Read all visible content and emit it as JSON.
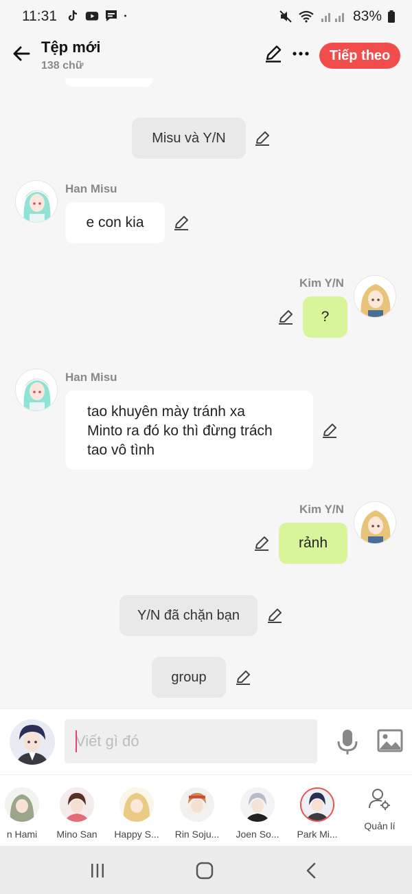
{
  "status_bar": {
    "time": "11:31",
    "battery": "83%",
    "left_icons": [
      "tiktok-icon",
      "youtube-icon",
      "message-icon",
      "dot-icon"
    ],
    "right_icons": [
      "mute-icon",
      "wifi-icon",
      "signal-icon",
      "battery-icon"
    ]
  },
  "header": {
    "title": "Tệp mới",
    "subtitle": "138 chữ",
    "next_label": "Tiếp theo",
    "accent_color": "#f24d4d"
  },
  "messages": [
    {
      "type": "narration",
      "text": "Misu và Y/N"
    },
    {
      "type": "incoming",
      "sender": "Han Misu",
      "text": "e con kia"
    },
    {
      "type": "outgoing",
      "sender": "Kim Y/N",
      "text": "?"
    },
    {
      "type": "incoming",
      "sender": "Han Misu",
      "lines": [
        "tao khuyên mày tránh xa",
        "Minto ra đó ko thì đừng trách",
        "tao vô tình"
      ]
    },
    {
      "type": "outgoing",
      "sender": "Kim Y/N",
      "text": "rảnh"
    },
    {
      "type": "narration",
      "text": "Y/N đã chặn bạn"
    },
    {
      "type": "narration",
      "text": "group"
    }
  ],
  "composer": {
    "placeholder": "Viết gì đó"
  },
  "characters": [
    {
      "name": "n Hami"
    },
    {
      "name": "Mino San"
    },
    {
      "name": "Happy S..."
    },
    {
      "name": "Rin Soju..."
    },
    {
      "name": "Joen So..."
    },
    {
      "name": "Park Mi...",
      "selected": true
    }
  ],
  "manage_label": "Quản lí",
  "colors": {
    "outgoing_bubble": "#d9f59b",
    "incoming_bubble": "#ffffff",
    "narration_bubble": "#e9e9e9"
  }
}
